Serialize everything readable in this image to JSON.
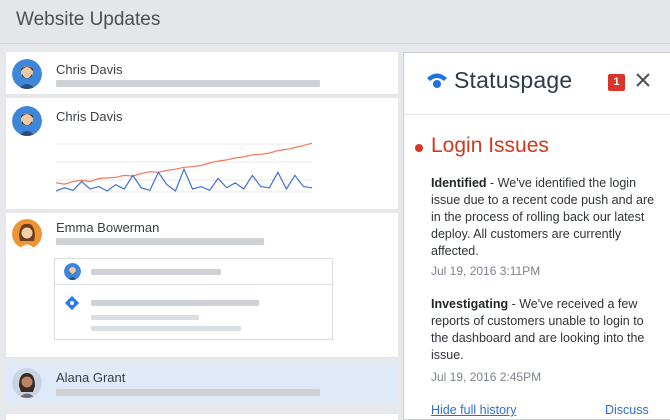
{
  "header": {
    "title": "Website Updates"
  },
  "feed": {
    "posts": [
      {
        "name": "Chris Davis"
      },
      {
        "name": "Chris Davis"
      },
      {
        "name": "Emma Bowerman"
      },
      {
        "name": "Alana Grant"
      }
    ]
  },
  "chart_data": {
    "type": "line",
    "title": "",
    "xlabel": "",
    "ylabel": "",
    "series": [
      {
        "color": "#f07a5a",
        "values": [
          0.18,
          0.16,
          0.2,
          0.22,
          0.2,
          0.25,
          0.26,
          0.27,
          0.3,
          0.29,
          0.33,
          0.36,
          0.35,
          0.38,
          0.4,
          0.43,
          0.44,
          0.46,
          0.5,
          0.53,
          0.55,
          0.58,
          0.6,
          0.63,
          0.64,
          0.66,
          0.7,
          0.72,
          0.75,
          0.78,
          0.82
        ]
      },
      {
        "color": "#3f72d1",
        "values": [
          0.05,
          0.1,
          0.06,
          0.2,
          0.08,
          0.12,
          0.05,
          0.15,
          0.08,
          0.3,
          0.1,
          0.06,
          0.35,
          0.15,
          0.05,
          0.4,
          0.08,
          0.12,
          0.06,
          0.25,
          0.1,
          0.18,
          0.08,
          0.3,
          0.12,
          0.1,
          0.35,
          0.08,
          0.3,
          0.12,
          0.1
        ]
      }
    ]
  },
  "statuspage": {
    "brand": "Statuspage",
    "badge_count": "1",
    "incident": {
      "title": "Login Issues",
      "updates": [
        {
          "status": "Identified",
          "text": " - We've identified the login issue due to a recent code push and are in the process of rolling back our latest deploy. All customers are currently affected.",
          "time": "Jul 19, 2016 3:11PM"
        },
        {
          "status": "Investigating",
          "text": " - We've received a few reports of customers unable to login to the dashboard and are looking into the issue.",
          "time": "Jul 19, 2016 2:45PM"
        }
      ]
    },
    "footer": {
      "history_link": "Hide full history",
      "discuss_link": "Discuss"
    }
  },
  "colors": {
    "accent": "#2d6fd6",
    "incident_red": "#d9352a",
    "brand_blue": "#1f6fe0"
  }
}
